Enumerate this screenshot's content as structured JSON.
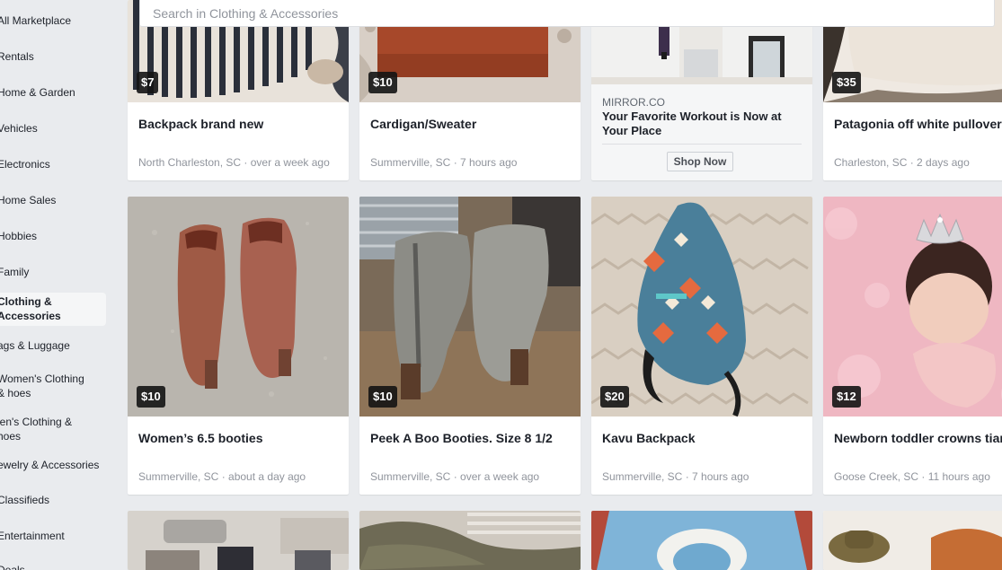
{
  "sidebar": {
    "items": [
      {
        "label": "All Marketplace"
      },
      {
        "label": "Rentals"
      },
      {
        "label": "Home & Garden"
      },
      {
        "label": "Vehicles"
      },
      {
        "label": "Electronics"
      },
      {
        "label": "Home Sales"
      },
      {
        "label": "Hobbies"
      },
      {
        "label": "Family"
      },
      {
        "label": "Clothing & Accessories"
      },
      {
        "label": "ags & Luggage"
      },
      {
        "label": "Women's Clothing & hoes"
      },
      {
        "label": "len's Clothing & hoes"
      },
      {
        "label": "ewelry & Accessories"
      },
      {
        "label": "Classifieds"
      },
      {
        "label": "Entertainment"
      },
      {
        "label": "Deals"
      }
    ],
    "active_index": 8
  },
  "search": {
    "placeholder": "Search in Clothing & Accessories",
    "value": ""
  },
  "row1": [
    {
      "price": "$7",
      "title": "Backpack brand new",
      "location": "North Charleston, SC",
      "time": "over a week ago"
    },
    {
      "price": "$10",
      "title": "Cardigan/Sweater",
      "location": "Summerville, SC",
      "time": "7 hours ago"
    },
    {
      "ad": true,
      "domain": "MIRROR.CO",
      "headline": "Your Favorite Workout is Now at Your Place",
      "cta": "Shop Now"
    },
    {
      "price": "$35",
      "title": "Patagonia off white pullover M",
      "location": "Charleston, SC",
      "time": "2 days ago"
    }
  ],
  "row2": [
    {
      "price": "$10",
      "title": "Women’s 6.5 booties",
      "location": "Summerville, SC",
      "time": "about a day ago"
    },
    {
      "price": "$10",
      "title": "Peek A Boo Booties. Size 8 1/2",
      "location": "Summerville, SC",
      "time": "over a week ago"
    },
    {
      "price": "$20",
      "title": "Kavu Backpack",
      "location": "Summerville, SC",
      "time": "7 hours ago"
    },
    {
      "price": "$12",
      "title": "Newborn toddler crowns tiaras",
      "location": "Goose Creek, SC",
      "time": "11 hours ago"
    }
  ],
  "meta_separator": " · "
}
